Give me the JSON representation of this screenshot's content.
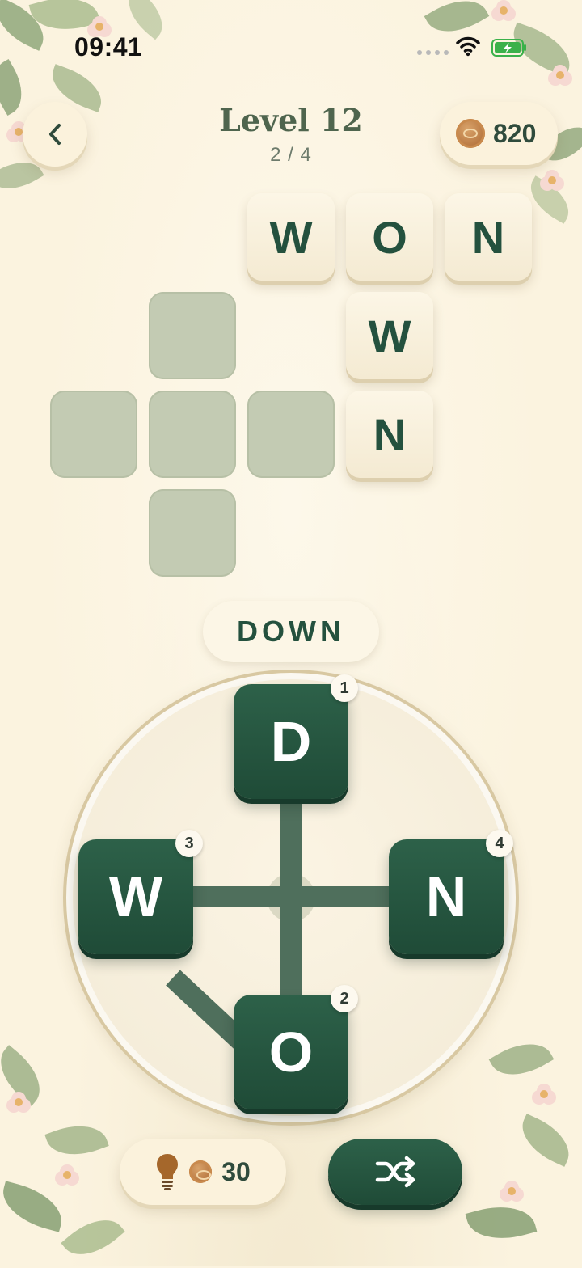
{
  "status_bar": {
    "time": "09:41"
  },
  "header": {
    "level_title": "Level 12",
    "progress": "2 / 4",
    "coins": "820"
  },
  "grid": {
    "found_words": [
      "WON",
      "OWN"
    ],
    "filled_letters": [
      "W",
      "O",
      "N",
      "W",
      "N"
    ]
  },
  "current_word": "DOWN",
  "wheel": {
    "letters": [
      {
        "letter": "D",
        "order": "1"
      },
      {
        "letter": "O",
        "order": "2"
      },
      {
        "letter": "W",
        "order": "3"
      },
      {
        "letter": "N",
        "order": "4"
      }
    ]
  },
  "controls": {
    "hint_cost": "30",
    "hint_icon": "lightbulb-icon",
    "shuffle_icon": "shuffle-icon",
    "coin_icon": "coin-icon"
  },
  "colors": {
    "background": "#fbf3df",
    "tile_filled": "#f8efd9",
    "tile_empty": "#c3cbb3",
    "accent_green": "#1f4b37",
    "text_green": "#24513e"
  }
}
